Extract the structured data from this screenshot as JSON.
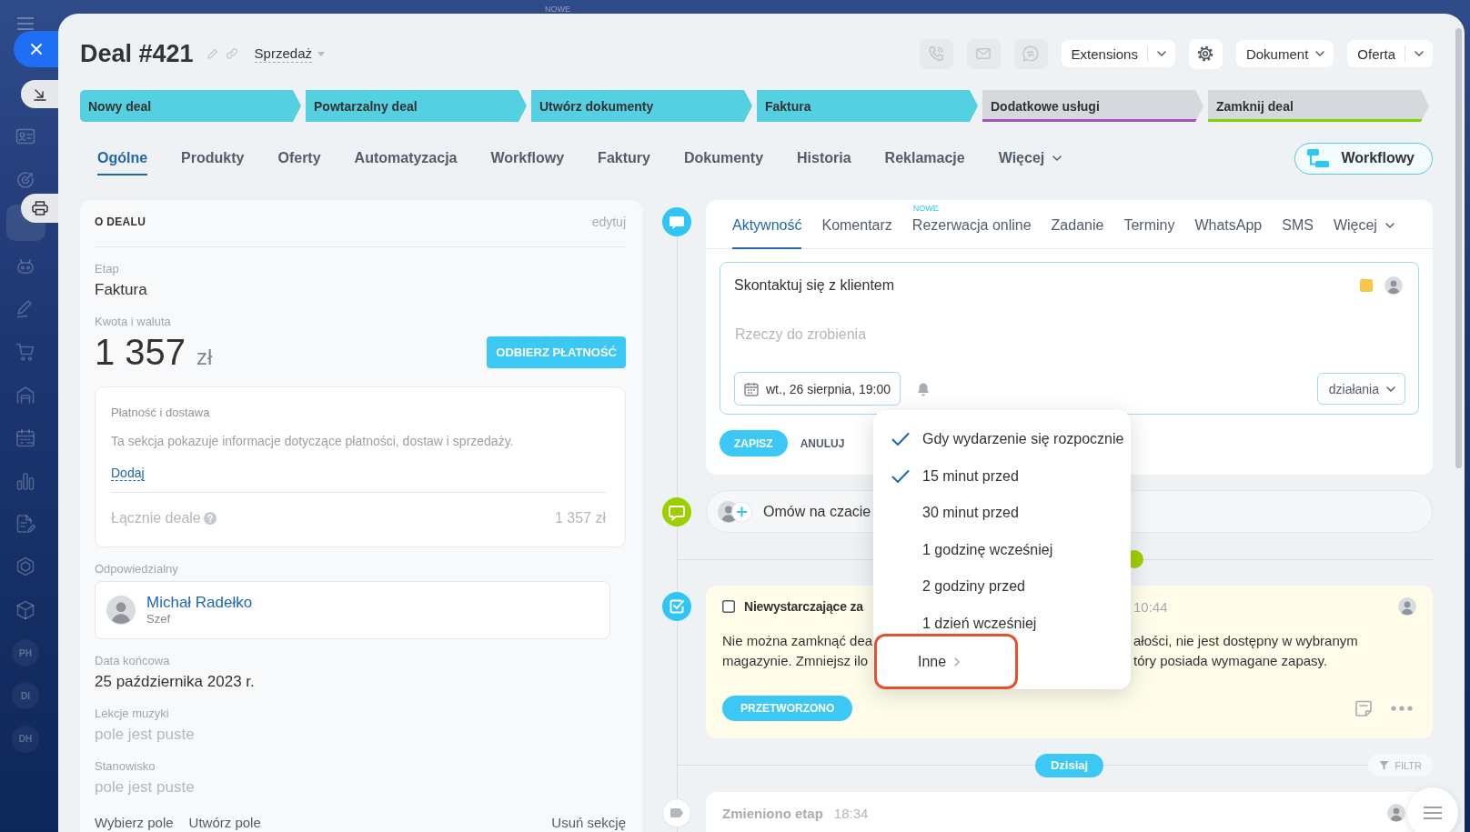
{
  "top_strip": {
    "badge": "NOWE"
  },
  "sidebar": {
    "items": [
      {
        "kind": "icon",
        "selected": false
      },
      {
        "kind": "icon",
        "selected": false
      },
      {
        "kind": "covered",
        "selected": true
      },
      {
        "kind": "icon",
        "selected": false
      },
      {
        "kind": "icon",
        "selected": false
      },
      {
        "kind": "icon",
        "selected": false
      },
      {
        "kind": "icon",
        "selected": false
      },
      {
        "kind": "icon",
        "selected": false
      },
      {
        "kind": "icon",
        "selected": false
      },
      {
        "kind": "icon",
        "selected": false
      },
      {
        "kind": "icon",
        "selected": false
      },
      {
        "kind": "icon",
        "selected": false
      },
      {
        "kind": "initials",
        "label": "PH",
        "selected": false
      },
      {
        "kind": "initials",
        "label": "DI",
        "selected": false
      },
      {
        "kind": "initials",
        "label": "DH",
        "selected": false
      }
    ]
  },
  "header": {
    "title": "Deal #421",
    "pipeline": "Sprzedaż",
    "actions": [
      {
        "kind": "icon",
        "disabled": true
      },
      {
        "kind": "icon",
        "disabled": true
      },
      {
        "kind": "icon",
        "disabled": true
      },
      {
        "kind": "split",
        "label": "Extensions",
        "disabled": false
      },
      {
        "kind": "icon",
        "disabled": false
      },
      {
        "kind": "dropdown",
        "label": "Dokument",
        "disabled": false
      },
      {
        "kind": "split",
        "label": "Oferta",
        "disabled": false
      }
    ]
  },
  "stages": [
    {
      "label": "Nowy deal",
      "done": true,
      "color": "#55d0e0"
    },
    {
      "label": "Powtarzalny deal",
      "done": true,
      "color": "#55d0e0"
    },
    {
      "label": "Utwórz dokumenty",
      "done": true,
      "color": "#55d0e0"
    },
    {
      "label": "Faktura",
      "done": true,
      "color": "#55d0e0"
    },
    {
      "label": "Dodatkowe usługi",
      "done": false,
      "color": "#a64fc0"
    },
    {
      "label": "Zamknij deal",
      "done": false,
      "color": "#7bd500"
    }
  ],
  "tabs": [
    {
      "label": "Ogólne",
      "kind": "tab",
      "selected": true
    },
    {
      "label": "Produkty",
      "kind": "tab",
      "selected": false
    },
    {
      "label": "Oferty",
      "kind": "tab",
      "selected": false
    },
    {
      "label": "Automatyzacja",
      "kind": "tab",
      "selected": false
    },
    {
      "label": "Workflowy",
      "kind": "tab",
      "selected": false
    },
    {
      "label": "Faktury",
      "kind": "tab",
      "selected": false
    },
    {
      "label": "Dokumenty",
      "kind": "tab",
      "selected": false
    },
    {
      "label": "Historia",
      "kind": "tab",
      "selected": false
    },
    {
      "label": "Reklamacje",
      "kind": "tab",
      "selected": false
    },
    {
      "label": "Więcej",
      "kind": "menu",
      "selected": false
    }
  ],
  "workflow_button": "Workflowy",
  "deal_card": {
    "title": "O DEALU",
    "edit": "edytuj",
    "fields": [
      {
        "kind": "text",
        "label": "Etap",
        "value": "Faktura"
      },
      {
        "kind": "money",
        "label": "Kwota i waluta",
        "amount": "1 357",
        "currency": "zł",
        "button": "ODBIERZ PŁATNOŚĆ"
      },
      {
        "kind": "payment",
        "title": "Płatność i dostawa",
        "text": "Ta sekcja pokazuje informacje dotyczące płatności, dostaw i sprzedaży.",
        "link": "Dodaj",
        "total_label": "Łącznie deale",
        "total": "1 357 zł"
      },
      {
        "kind": "person",
        "label": "Odpowiedzialny",
        "name": "Michał Radełko",
        "role": "Szef"
      },
      {
        "kind": "text",
        "label": "Data końcowa",
        "value": "25 października 2023 r."
      },
      {
        "kind": "empty",
        "label": "Lekcje muzyki",
        "value": "pole jest puste"
      },
      {
        "kind": "empty",
        "label": "Stanowisko",
        "value": "pole jest puste"
      }
    ],
    "footer": {
      "links": [
        "Wybierz pole",
        "Utwórz pole"
      ],
      "remove": "Usuń sekcję"
    }
  },
  "activity": {
    "tabs": [
      {
        "label": "Aktywność",
        "kind": "tab",
        "selected": true
      },
      {
        "label": "Komentarz",
        "kind": "tab",
        "selected": false
      },
      {
        "label": "Rezerwacja online",
        "kind": "tab",
        "selected": false,
        "badge": "NOWE"
      },
      {
        "label": "Zadanie",
        "kind": "tab",
        "selected": false
      },
      {
        "label": "Terminy",
        "kind": "tab",
        "selected": false
      },
      {
        "label": "WhatsApp",
        "kind": "tab",
        "selected": false
      },
      {
        "label": "SMS",
        "kind": "tab",
        "selected": false
      },
      {
        "label": "Więcej",
        "kind": "menu",
        "selected": false
      }
    ],
    "editor": {
      "title": "Skontaktuj się z klientem",
      "placeholder": "Rzeczy do zrobienia",
      "date": "wt., 26 sierpnia, 19:00",
      "actions": "działania"
    },
    "save": "ZAPISZ",
    "cancel": "ANULUJ"
  },
  "reminder_menu": {
    "items": [
      {
        "label": "Gdy wydarzenie się rozpocznie",
        "kind": "option",
        "checked": true,
        "highlighted": false
      },
      {
        "label": "15 minut przed",
        "kind": "option",
        "checked": true,
        "highlighted": false
      },
      {
        "label": "30 minut przed",
        "kind": "option",
        "checked": false,
        "highlighted": false
      },
      {
        "label": "1 godzinę wcześniej",
        "kind": "option",
        "checked": false,
        "highlighted": false
      },
      {
        "label": "2 godziny przed",
        "kind": "option",
        "checked": false,
        "highlighted": false
      },
      {
        "label": "1 dzień wcześniej",
        "kind": "option",
        "checked": false,
        "highlighted": false
      },
      {
        "label": "Inne",
        "kind": "submenu",
        "checked": false,
        "highlighted": true
      }
    ]
  },
  "chat": {
    "label": "Omów na czacie"
  },
  "task": {
    "checked": false,
    "title": "Niewystarczające za",
    "time": "10:44",
    "text_left": [
      "Nie można zamknąć dea",
      "magazynie. Zmniejsz ilo"
    ],
    "text_right": [
      "ałości, nie jest dostępny w wybranym",
      "tóry posiada wymagane zapasy."
    ],
    "button": "PRZETWORZONO"
  },
  "today": {
    "label": "Dzisiaj",
    "filter": "FILTR"
  },
  "history": {
    "title": "Zmieniono etap",
    "time": "18:34"
  }
}
